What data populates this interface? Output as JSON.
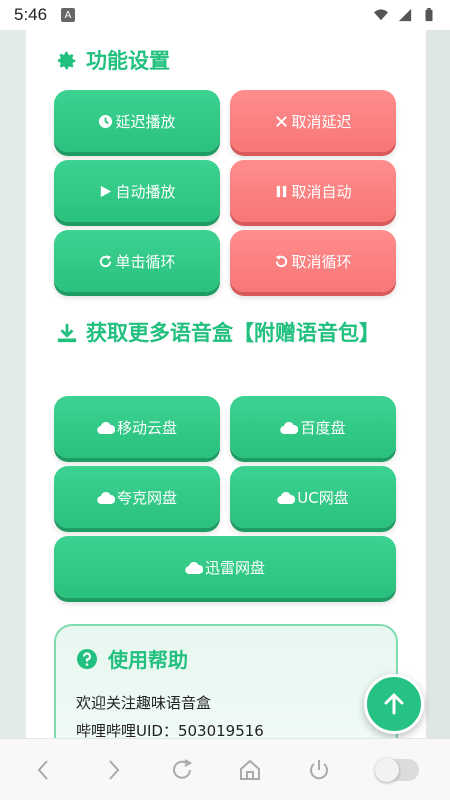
{
  "status_bar": {
    "time": "5:46",
    "notification": "A"
  },
  "settings": {
    "title": "功能设置",
    "buttons": [
      {
        "label": "延迟播放",
        "icon": "clock-icon",
        "color": "green"
      },
      {
        "label": "取消延迟",
        "icon": "close-icon",
        "color": "red"
      },
      {
        "label": "自动播放",
        "icon": "play-icon",
        "color": "green"
      },
      {
        "label": "取消自动",
        "icon": "pause-icon",
        "color": "red"
      },
      {
        "label": "单击循环",
        "icon": "redo-icon",
        "color": "green"
      },
      {
        "label": "取消循环",
        "icon": "undo-icon",
        "color": "red"
      }
    ]
  },
  "download": {
    "title": "获取更多语音盒【附赠语音包】",
    "buttons": [
      {
        "label": "移动云盘",
        "icon": "cloud-icon"
      },
      {
        "label": "百度盘",
        "icon": "cloud-icon"
      },
      {
        "label": "夸克网盘",
        "icon": "cloud-icon"
      },
      {
        "label": "UC网盘",
        "icon": "cloud-icon"
      },
      {
        "label": "迅雷网盘",
        "icon": "cloud-icon"
      }
    ]
  },
  "help": {
    "title": "使用帮助",
    "line1": "欢迎关注趣味语音盒",
    "line2": "哔哩哔哩UID：503019516"
  },
  "colors": {
    "accent": "#22c07e",
    "green_button": "#2ac07d",
    "red_button": "#f87676"
  }
}
